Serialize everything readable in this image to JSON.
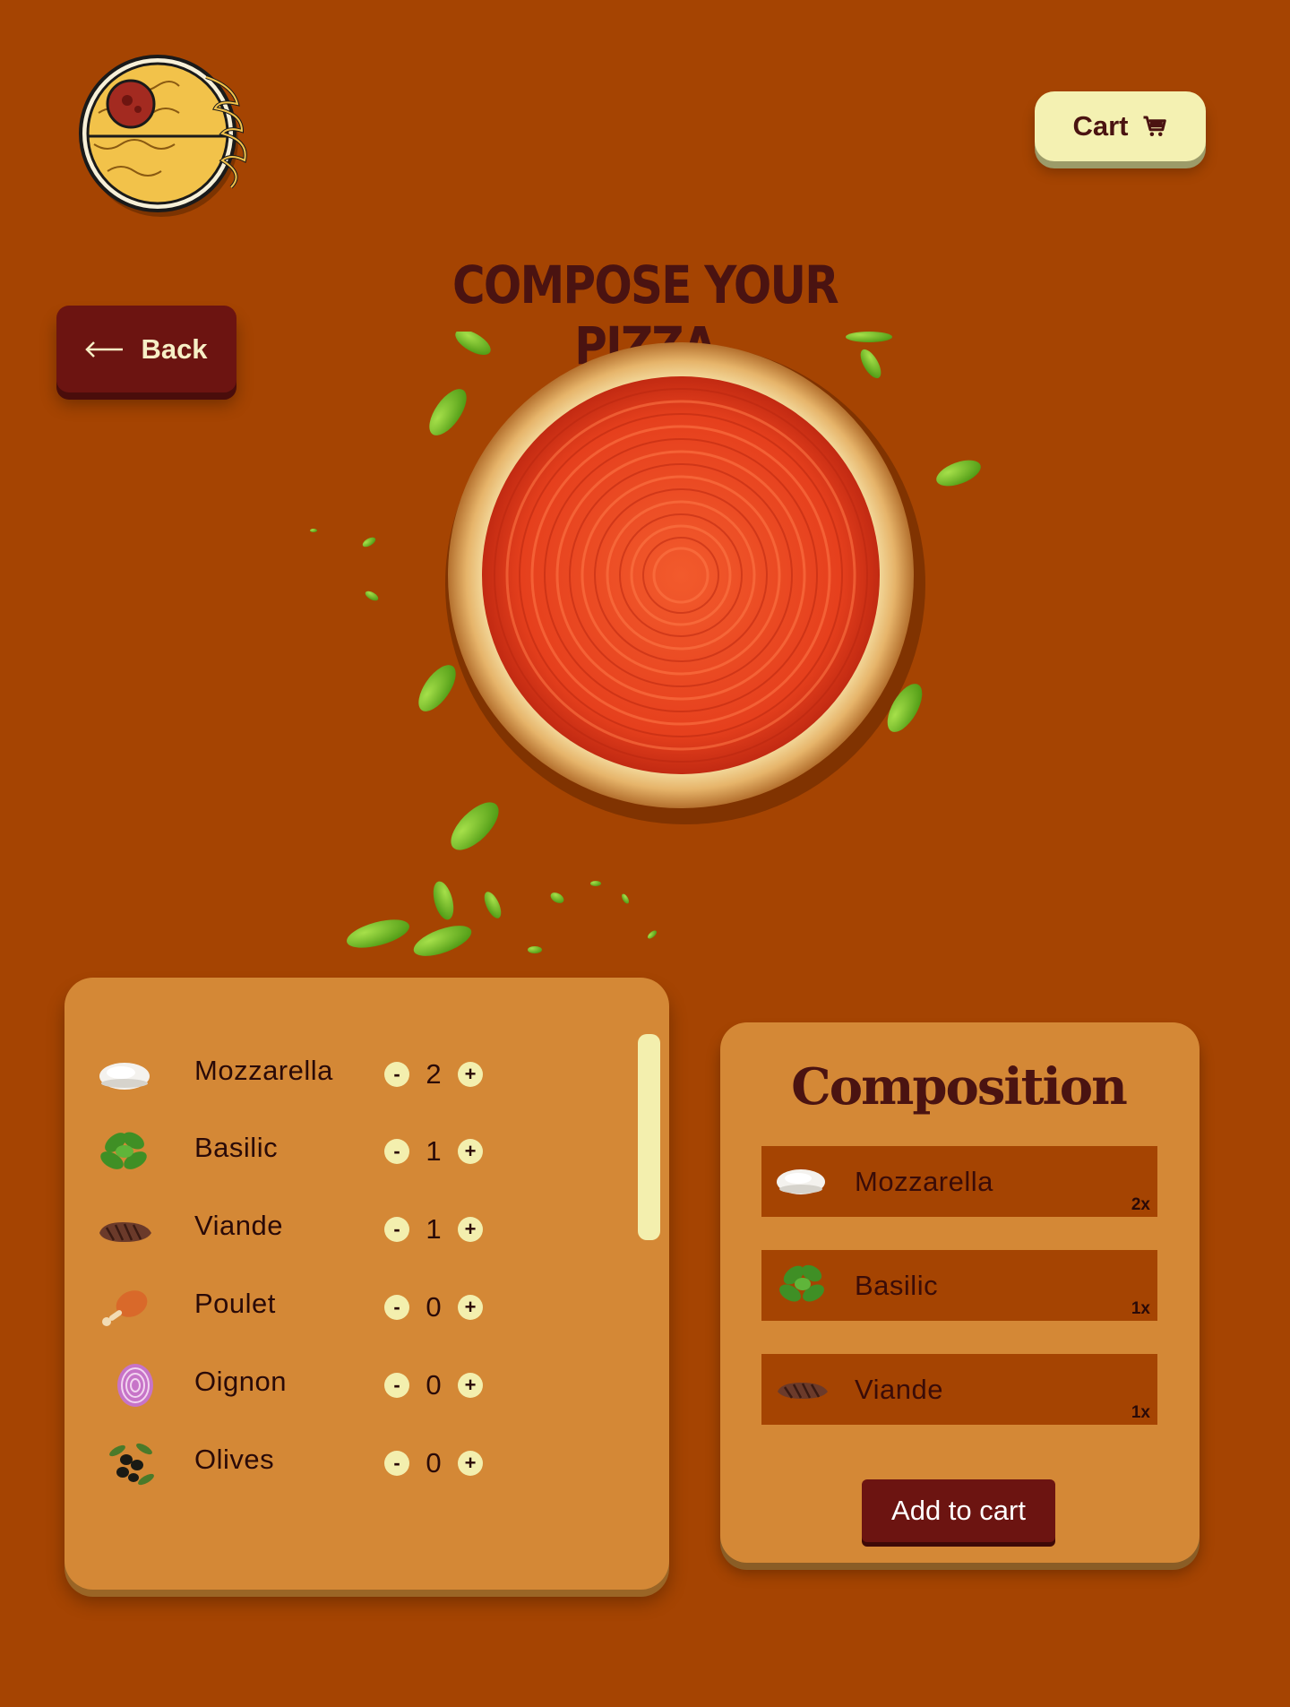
{
  "header": {
    "logo_icon": "pizza-logo-icon",
    "cart_label": "Cart",
    "cart_icon": "cart-icon"
  },
  "back": {
    "label": "Back",
    "icon": "arrow-left-icon"
  },
  "title": "COMPOSE YOUR PIZZA",
  "ingredients": [
    {
      "name": "Mozzarella",
      "icon": "mozzarella-icon",
      "qty": "2"
    },
    {
      "name": "Basilic",
      "icon": "basil-icon",
      "qty": "1"
    },
    {
      "name": "Viande",
      "icon": "meat-icon",
      "qty": "1"
    },
    {
      "name": "Poulet",
      "icon": "chicken-icon",
      "qty": "0"
    },
    {
      "name": "Oignon",
      "icon": "onion-icon",
      "qty": "0"
    },
    {
      "name": "Olives",
      "icon": "olives-icon",
      "qty": "0"
    }
  ],
  "stepper": {
    "minus": "-",
    "plus": "+"
  },
  "composition": {
    "title": "Composition",
    "items": [
      {
        "name": "Mozzarella",
        "icon": "mozzarella-icon",
        "qty": "2x"
      },
      {
        "name": "Basilic",
        "icon": "basil-icon",
        "qty": "1x"
      },
      {
        "name": "Viande",
        "icon": "meat-icon",
        "qty": "1x"
      }
    ],
    "add_label": "Add to cart"
  },
  "colors": {
    "background": "#a54402",
    "panel": "#d48836",
    "accent_dark": "#6c1411",
    "accent_light": "#f4f1b2",
    "text_dark": "#4a1311"
  }
}
